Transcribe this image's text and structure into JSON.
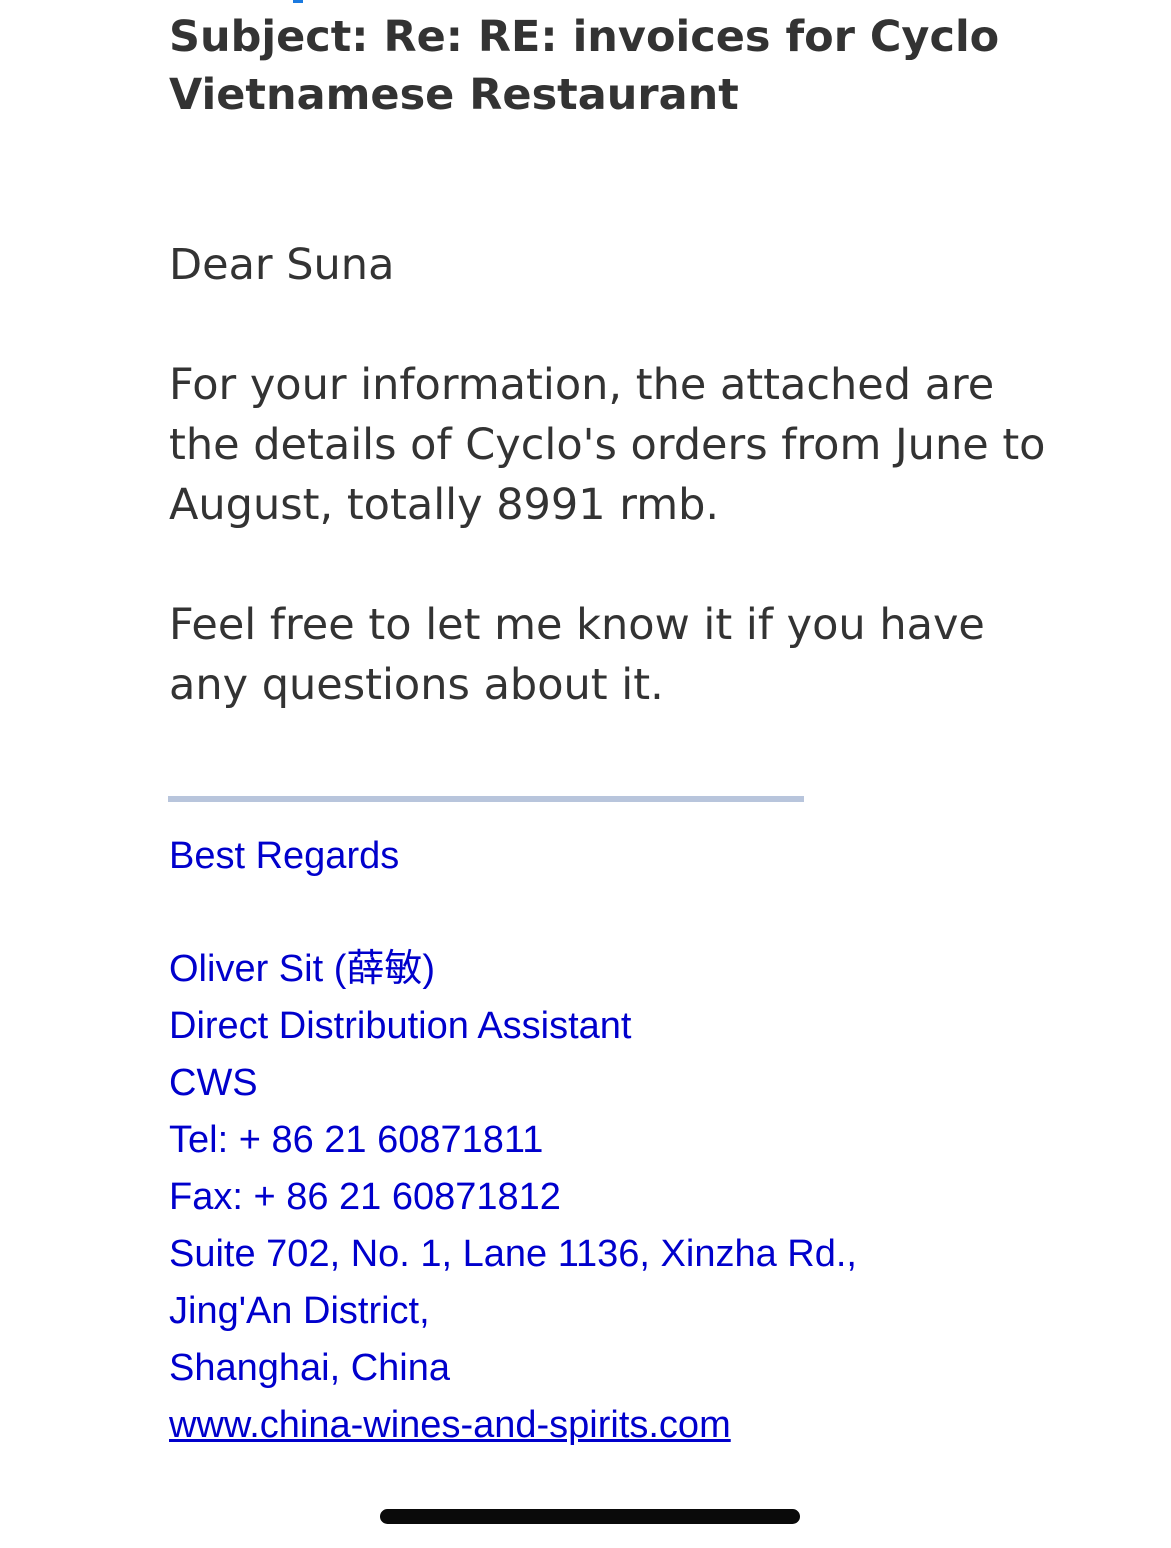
{
  "email": {
    "subject": "Subject: Re: RE: invoices for Cyclo Vietnamese Restaurant",
    "greeting": "Dear Suna",
    "paragraph_1": "For your information, the attached are the details of Cyclo's orders from June to August, totally 8991 rmb.",
    "paragraph_2": "Feel free to let me know it if you have any questions about it."
  },
  "signature": {
    "regards": "Best Regards",
    "name": "Oliver Sit (薛敏)",
    "title": "Direct Distribution Assistant",
    "company": "CWS",
    "tel": "Tel:  + 86 21 60871811",
    "fax": "Fax: + 86 21 60871812",
    "address_line_1": "Suite 702, No. 1, Lane 1136, Xinzha Rd.,",
    "address_line_2": "Jing'An District,",
    "address_line_3": "Shanghai, China",
    "website": "www.china-wines-and-spirits.com"
  },
  "colors": {
    "body_text": "#333333",
    "signature_text": "#0000cc",
    "divider": "#b8c5dc",
    "home_indicator": "#0a0a0a"
  }
}
